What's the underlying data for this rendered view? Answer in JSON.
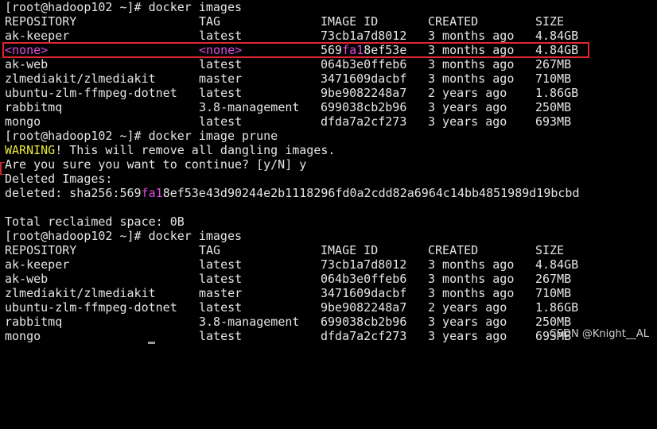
{
  "commands": {
    "images1": "[root@hadoop102 ~]# docker images",
    "prune": "[root@hadoop102 ~]# docker image prune",
    "images2": "[root@hadoop102 ~]# docker images"
  },
  "headers": {
    "repository": "REPOSITORY",
    "tag": "TAG",
    "image_id": "IMAGE ID",
    "created": "CREATED",
    "size": "SIZE"
  },
  "table1": [
    {
      "repo": "ak-keeper",
      "tag": "latest",
      "id": "73cb1a7d8012",
      "created": "3 months ago",
      "size": "4.84GB"
    },
    {
      "repo": "<none>",
      "tag": "<none>",
      "id_pre": "569",
      "id_mid": "fa1",
      "id_post": "8ef53e",
      "created": "3 months ago",
      "size": "4.84GB"
    },
    {
      "repo": "ak-web",
      "tag": "latest",
      "id": "064b3e0ffeb6",
      "created": "3 months ago",
      "size": "267MB"
    },
    {
      "repo": "zlmediakit/zlmediakit",
      "tag": "master",
      "id": "3471609dacbf",
      "created": "3 months ago",
      "size": "710MB"
    },
    {
      "repo": "ubuntu-zlm-ffmpeg-dotnet",
      "tag": "latest",
      "id": "9be9082248a7",
      "created": "2 years ago",
      "size": "1.86GB"
    },
    {
      "repo": "rabbitmq",
      "tag": "3.8-management",
      "id": "699038cb2b96",
      "created": "3 years ago",
      "size": "250MB"
    },
    {
      "repo": "mongo",
      "tag": "latest",
      "id": "dfda7a2cf273",
      "created": "3 years ago",
      "size": "693MB"
    }
  ],
  "prune_output": {
    "warning_word": "WARNING",
    "warning_rest": "! This will remove all dangling images.",
    "confirm": "Are you sure you want to continue? [y/N] y",
    "deleted_header": "Deleted Images:",
    "deleted_pre": "deleted: sha256:569",
    "deleted_mid": "fa1",
    "deleted_post": "8ef53e43d90244e2b1118296fd0a2cdd82a6964c14bb4851989d19bcbd",
    "reclaimed": "Total reclaimed space: 0B"
  },
  "table2": [
    {
      "repo": "ak-keeper",
      "tag": "latest",
      "id": "73cb1a7d8012",
      "created": "3 months ago",
      "size": "4.84GB"
    },
    {
      "repo": "ak-web",
      "tag": "latest",
      "id": "064b3e0ffeb6",
      "created": "3 months ago",
      "size": "267MB"
    },
    {
      "repo": "zlmediakit/zlmediakit",
      "tag": "master",
      "id": "3471609dacbf",
      "created": "3 months ago",
      "size": "710MB"
    },
    {
      "repo": "ubuntu-zlm-ffmpeg-dotnet",
      "tag": "latest",
      "id": "9be9082248a7",
      "created": "2 years ago",
      "size": "1.86GB"
    },
    {
      "repo": "rabbitmq",
      "tag": "3.8-management",
      "id": "699038cb2b96",
      "created": "3 years ago",
      "size": "250MB"
    },
    {
      "repo": "mongo",
      "tag": "latest",
      "id": "dfda7a2cf273",
      "created": "3 years ago",
      "size": "693MB"
    }
  ],
  "watermark": "CSDN @Knight__AL",
  "colors": {
    "background": "#000000",
    "text": "#e5e5e5",
    "highlight": "#e04be0",
    "warning": "#e8e83a",
    "annotation_box": "#e0262b"
  }
}
